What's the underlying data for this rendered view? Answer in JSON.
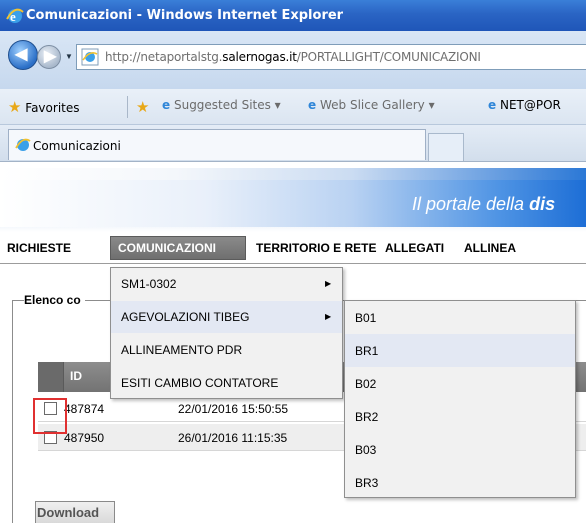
{
  "window": {
    "title": "Comunicazioni - Windows Internet Explorer",
    "url_prefix": "http://netaportalstg.",
    "url_domain": "salernogas.it",
    "url_path": "/PORTALLIGHT/COMUNICAZIONI"
  },
  "favorites_bar": {
    "favorites_label": "Favorites",
    "items": [
      "Suggested Sites ▾",
      "Web Slice Gallery ▾",
      "NET@POR"
    ]
  },
  "tab": {
    "label": "Comunicazioni"
  },
  "banner": {
    "text_prefix": "Il portale della ",
    "text_bold": "dis"
  },
  "nav": {
    "items": [
      "RICHIESTE",
      "COMUNICAZIONI",
      "TERRITORIO E RETE",
      "ALLEGATI",
      "ALLINEA"
    ],
    "active": "COMUNICAZIONI"
  },
  "section": {
    "legend": "Elenco co"
  },
  "table": {
    "columns": [
      "ID"
    ],
    "rows": [
      {
        "id": "487874",
        "date": "22/01/2016 15:50:55"
      },
      {
        "id": "487950",
        "date": "26/01/2016 11:15:35"
      }
    ]
  },
  "menu_comunicazioni": [
    {
      "label": "SM1-0302",
      "submenu": true
    },
    {
      "label": "AGEVOLAZIONI TIBEG",
      "submenu": true
    },
    {
      "label": "ALLINEAMENTO PDR",
      "submenu": false
    },
    {
      "label": "ESITI CAMBIO CONTATORE",
      "submenu": false
    }
  ],
  "submenu_agevolazioni": [
    "B01",
    "BR1",
    "B02",
    "BR2",
    "B03",
    "BR3"
  ],
  "buttons": {
    "download": "Download"
  },
  "colors": {
    "highlight_box": "#e03030",
    "titlebar": "#2a64c4",
    "active_nav": "#777777"
  }
}
